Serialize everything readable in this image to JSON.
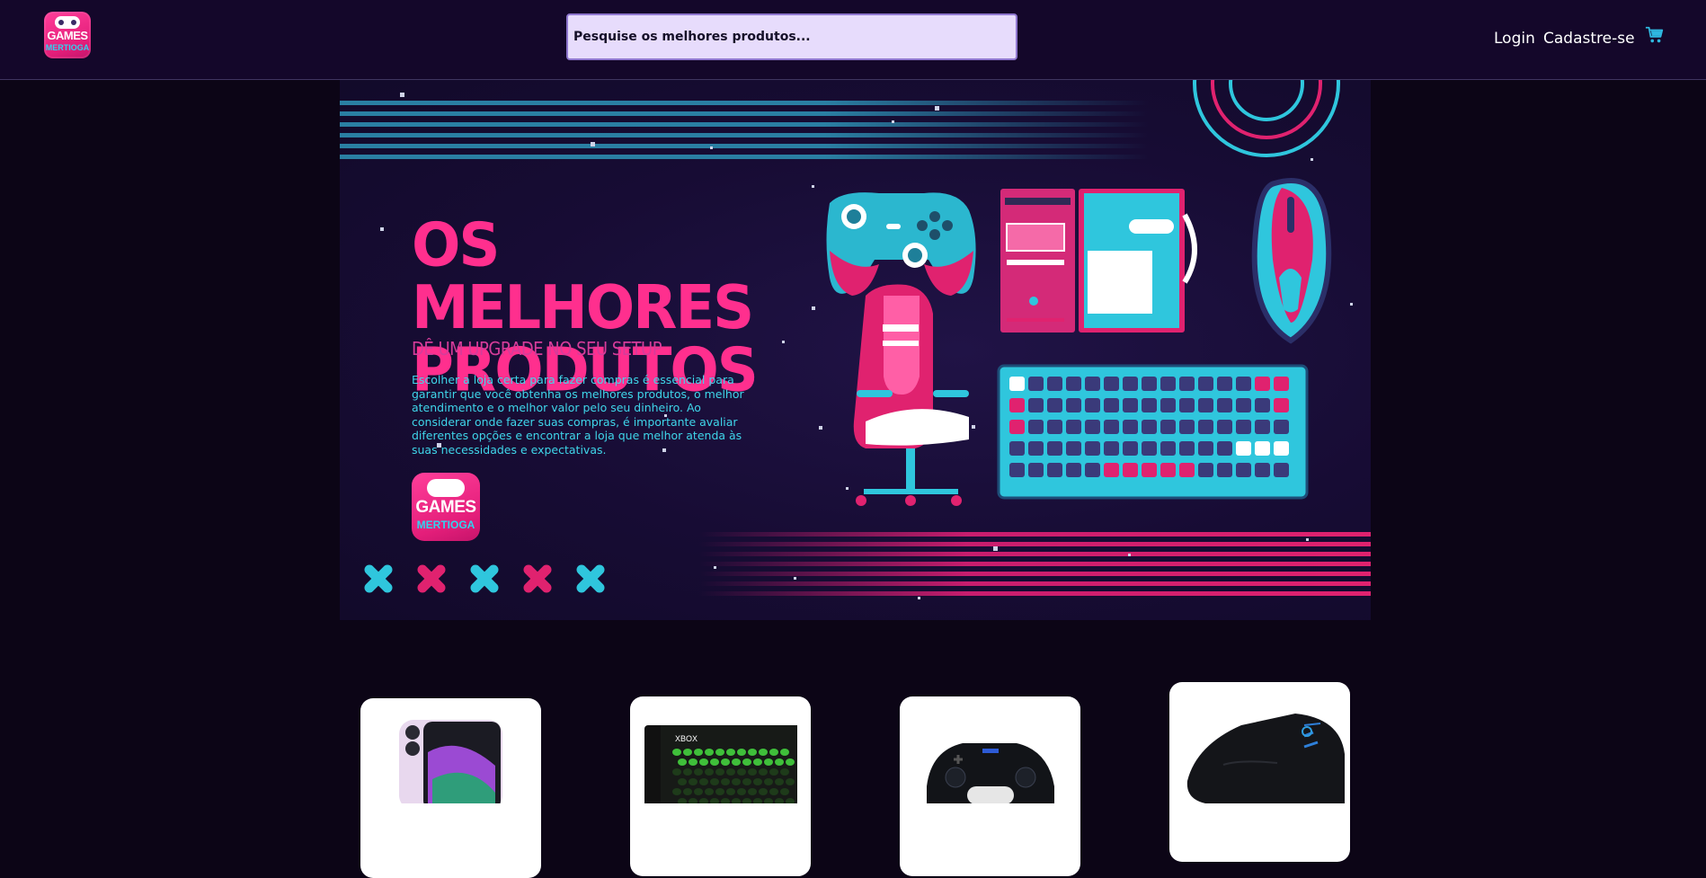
{
  "header": {
    "logo": {
      "title": "GAMES",
      "subtitle": "MERTIOGA"
    },
    "search": {
      "placeholder": "Pesquise os melhores produtos..."
    },
    "nav": {
      "login": "Login",
      "signup": "Cadastre-se"
    },
    "cart_icon": "shopping-cart-icon",
    "colors": {
      "background": "#14072a",
      "cart": "#2fb8e0"
    }
  },
  "banner": {
    "headline_line1": "OS MELHORES",
    "headline_line2": "PRODUTOS",
    "subheadline": "DÊ UM UPGRADE NO SEU SETUP",
    "body": "Escolher a loja certa para fazer compras é essencial para garantir que você obtenha os melhores produtos, o melhor atendimento e o melhor valor pelo seu dinheiro. Ao considerar onde fazer suas compras, é importante avaliar diferentes opções e encontrar a loja que melhor atenda às suas necessidades e expectativas.",
    "logo": {
      "title": "GAMES",
      "subtitle": "MERTIOGA"
    },
    "illustrations": [
      "gamepad-icon",
      "pc-tower-icon",
      "mouse-icon",
      "gaming-chair-icon",
      "keyboard-icon"
    ],
    "colors": {
      "pink": "#ff2f8e",
      "cyan": "#2fc6dd"
    }
  },
  "products": [
    {
      "image": "smartphone-image"
    },
    {
      "image": "console-image"
    },
    {
      "image": "controller-image"
    },
    {
      "image": "gaming-mouse-image"
    }
  ]
}
